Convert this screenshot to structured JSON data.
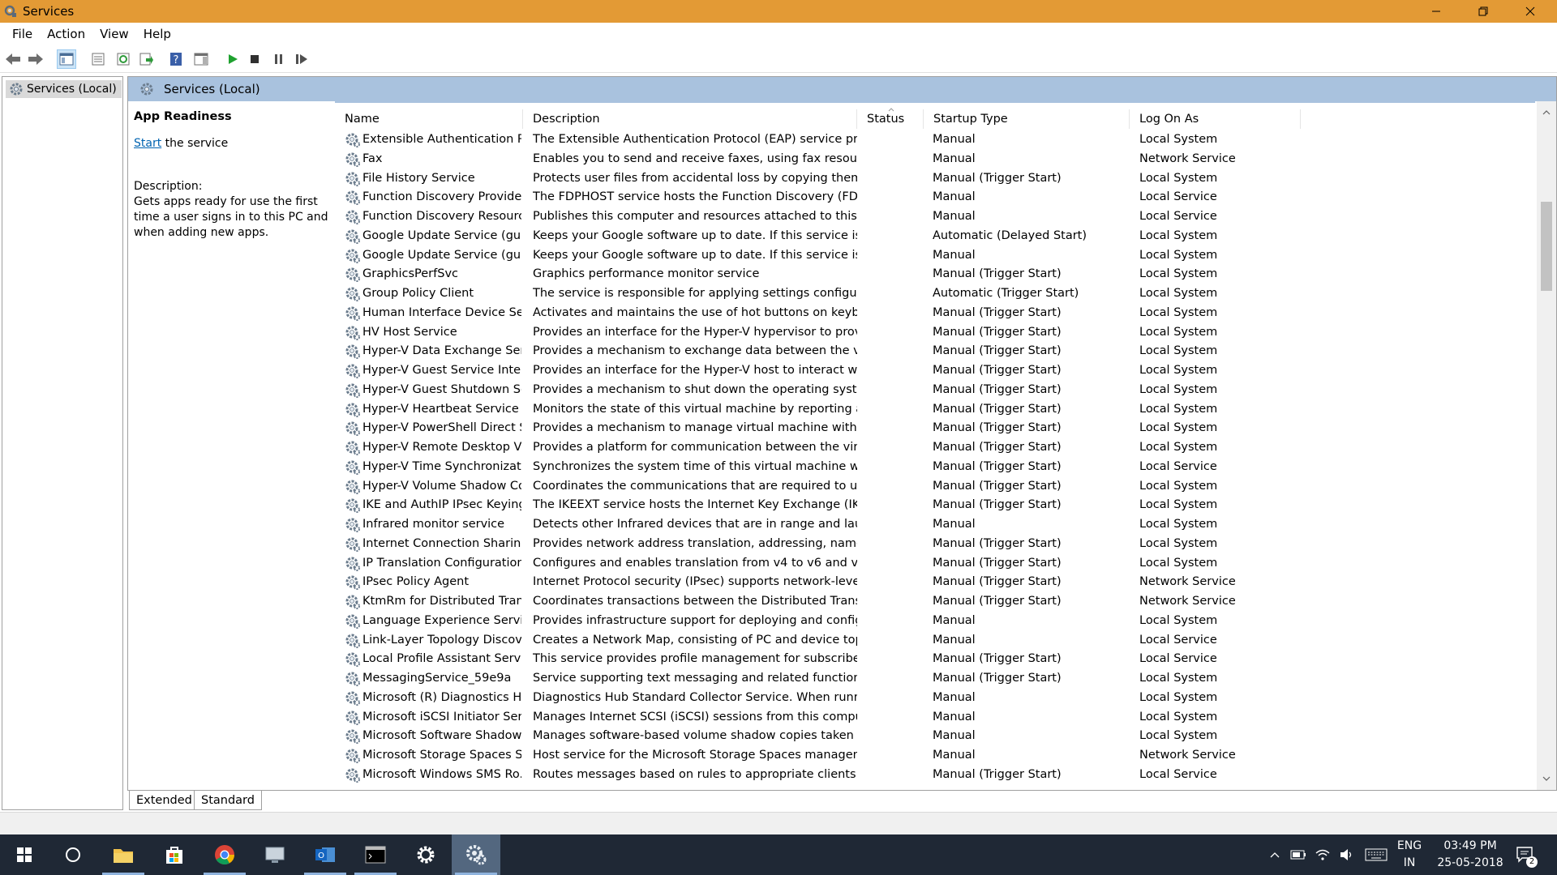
{
  "window": {
    "title": "Services",
    "menu": [
      "File",
      "Action",
      "View",
      "Help"
    ]
  },
  "tree": {
    "root_label": "Services (Local)"
  },
  "panel": {
    "header_title": "Services (Local)",
    "selected_name": "App Readiness",
    "start_link": "Start",
    "start_suffix": " the service",
    "description_label": "Description:",
    "description_text": "Gets apps ready for use the first time a user signs in to this PC and when adding new apps."
  },
  "columns": {
    "name": "Name",
    "description": "Description",
    "status": "Status",
    "startup": "Startup Type",
    "logon": "Log On As"
  },
  "services": [
    {
      "name": "Extensible Authentication Pr...",
      "description": "The Extensible Authentication Protocol (EAP) service provide...",
      "status": "",
      "startup": "Manual",
      "logon": "Local System"
    },
    {
      "name": "Fax",
      "description": "Enables you to send and receive faxes, using fax resources a...",
      "status": "",
      "startup": "Manual",
      "logon": "Network Service"
    },
    {
      "name": "File History Service",
      "description": "Protects user files from accidental loss by copying them to a...",
      "status": "",
      "startup": "Manual (Trigger Start)",
      "logon": "Local System"
    },
    {
      "name": "Function Discovery Provider ...",
      "description": "The FDPHOST service hosts the Function Discovery (FD) net...",
      "status": "",
      "startup": "Manual",
      "logon": "Local Service"
    },
    {
      "name": "Function Discovery Resourc...",
      "description": "Publishes this computer and resources attached to this com...",
      "status": "",
      "startup": "Manual",
      "logon": "Local Service"
    },
    {
      "name": "Google Update Service (gup...",
      "description": "Keeps your Google software up to date. If this service is disa...",
      "status": "",
      "startup": "Automatic (Delayed Start)",
      "logon": "Local System"
    },
    {
      "name": "Google Update Service (gup...",
      "description": "Keeps your Google software up to date. If this service is disa...",
      "status": "",
      "startup": "Manual",
      "logon": "Local System"
    },
    {
      "name": "GraphicsPerfSvc",
      "description": "Graphics performance monitor service",
      "status": "",
      "startup": "Manual (Trigger Start)",
      "logon": "Local System"
    },
    {
      "name": "Group Policy Client",
      "description": "The service is responsible for applying settings configured ...",
      "status": "",
      "startup": "Automatic (Trigger Start)",
      "logon": "Local System"
    },
    {
      "name": "Human Interface Device Serv",
      "description": "Activates and maintains the use of hot buttons on keyboar...",
      "status": "",
      "startup": "Manual (Trigger Start)",
      "logon": "Local System"
    },
    {
      "name": "HV Host Service",
      "description": "Provides an interface for the Hyper-V hypervisor to provide ...",
      "status": "",
      "startup": "Manual (Trigger Start)",
      "logon": "Local System"
    },
    {
      "name": "Hyper-V Data Exchange Serv",
      "description": "Provides a mechanism to exchange data between the virtual...",
      "status": "",
      "startup": "Manual (Trigger Start)",
      "logon": "Local System"
    },
    {
      "name": "Hyper-V Guest Service Interf",
      "description": "Provides an interface for the Hyper-V host to interact with s...",
      "status": "",
      "startup": "Manual (Trigger Start)",
      "logon": "Local System"
    },
    {
      "name": "Hyper-V Guest Shutdown Se...",
      "description": "Provides a mechanism to shut down the operating system o...",
      "status": "",
      "startup": "Manual (Trigger Start)",
      "logon": "Local System"
    },
    {
      "name": "Hyper-V Heartbeat Service",
      "description": "Monitors the state of this virtual machine by reporting a he...",
      "status": "",
      "startup": "Manual (Trigger Start)",
      "logon": "Local System"
    },
    {
      "name": "Hyper-V PowerShell Direct S...",
      "description": "Provides a mechanism to manage virtual machine with Pow...",
      "status": "",
      "startup": "Manual (Trigger Start)",
      "logon": "Local System"
    },
    {
      "name": "Hyper-V Remote Desktop Vi...",
      "description": "Provides a platform for communication between the virtual ...",
      "status": "",
      "startup": "Manual (Trigger Start)",
      "logon": "Local System"
    },
    {
      "name": "Hyper-V Time Synchronizati...",
      "description": "Synchronizes the system time of this virtual machine with t...",
      "status": "",
      "startup": "Manual (Trigger Start)",
      "logon": "Local Service"
    },
    {
      "name": "Hyper-V Volume Shadow Co...",
      "description": "Coordinates the communications that are required to use V...",
      "status": "",
      "startup": "Manual (Trigger Start)",
      "logon": "Local System"
    },
    {
      "name": "IKE and AuthIP IPsec Keying ...",
      "description": "The IKEEXT service hosts the Internet Key Exchange (IKE) an...",
      "status": "",
      "startup": "Manual (Trigger Start)",
      "logon": "Local System"
    },
    {
      "name": "Infrared monitor service",
      "description": "Detects other Infrared devices that are in range and launche...",
      "status": "",
      "startup": "Manual",
      "logon": "Local System"
    },
    {
      "name": "Internet Connection Sharing...",
      "description": "Provides network address translation, addressing, name res...",
      "status": "",
      "startup": "Manual (Trigger Start)",
      "logon": "Local System"
    },
    {
      "name": "IP Translation Configuration ...",
      "description": "Configures and enables translation from v4 to v6 and vice v...",
      "status": "",
      "startup": "Manual (Trigger Start)",
      "logon": "Local System"
    },
    {
      "name": "IPsec Policy Agent",
      "description": "Internet Protocol security (IPsec) supports network-level pee...",
      "status": "",
      "startup": "Manual (Trigger Start)",
      "logon": "Network Service"
    },
    {
      "name": "KtmRm for Distributed Trans...",
      "description": "Coordinates transactions between the Distributed Transacti...",
      "status": "",
      "startup": "Manual (Trigger Start)",
      "logon": "Network Service"
    },
    {
      "name": "Language Experience Service",
      "description": "Provides infrastructure support for deploying and configuri...",
      "status": "",
      "startup": "Manual",
      "logon": "Local System"
    },
    {
      "name": "Link-Layer Topology Discove...",
      "description": "Creates a Network Map, consisting of PC and device topolo...",
      "status": "",
      "startup": "Manual",
      "logon": "Local Service"
    },
    {
      "name": "Local Profile Assistant Service",
      "description": "This service provides profile management for subscriber ide...",
      "status": "",
      "startup": "Manual (Trigger Start)",
      "logon": "Local Service"
    },
    {
      "name": "MessagingService_59e9a",
      "description": "Service supporting text messaging and related functionality.",
      "status": "",
      "startup": "Manual (Trigger Start)",
      "logon": "Local System"
    },
    {
      "name": "Microsoft (R) Diagnostics Hu...",
      "description": "Diagnostics Hub Standard Collector Service. When running, ...",
      "status": "",
      "startup": "Manual",
      "logon": "Local System"
    },
    {
      "name": "Microsoft iSCSI Initiator Serv",
      "description": "Manages Internet SCSI (iSCSI) sessions from this computer t...",
      "status": "",
      "startup": "Manual",
      "logon": "Local System"
    },
    {
      "name": "Microsoft Software Shadow ...",
      "description": "Manages software-based volume shadow copies taken by t...",
      "status": "",
      "startup": "Manual",
      "logon": "Local System"
    },
    {
      "name": "Microsoft Storage Spaces S",
      "description": "Host service for the Microsoft Storage Spaces management ...",
      "status": "",
      "startup": "Manual",
      "logon": "Network Service"
    },
    {
      "name": "Microsoft Windows SMS Ro...",
      "description": "Routes messages based on rules to appropriate clients.",
      "status": "",
      "startup": "Manual (Trigger Start)",
      "logon": "Local Service"
    }
  ],
  "view_tabs": [
    "Extended",
    "Standard"
  ],
  "taskbar": {
    "language": "ENG",
    "region": "IN",
    "time": "03:49 PM",
    "date": "25-05-2018",
    "notification_count": "2"
  },
  "colors": {
    "titlebar": "#e39a35",
    "header": "#a9c2de",
    "taskbar": "#1f2835",
    "link": "#0063b1"
  }
}
